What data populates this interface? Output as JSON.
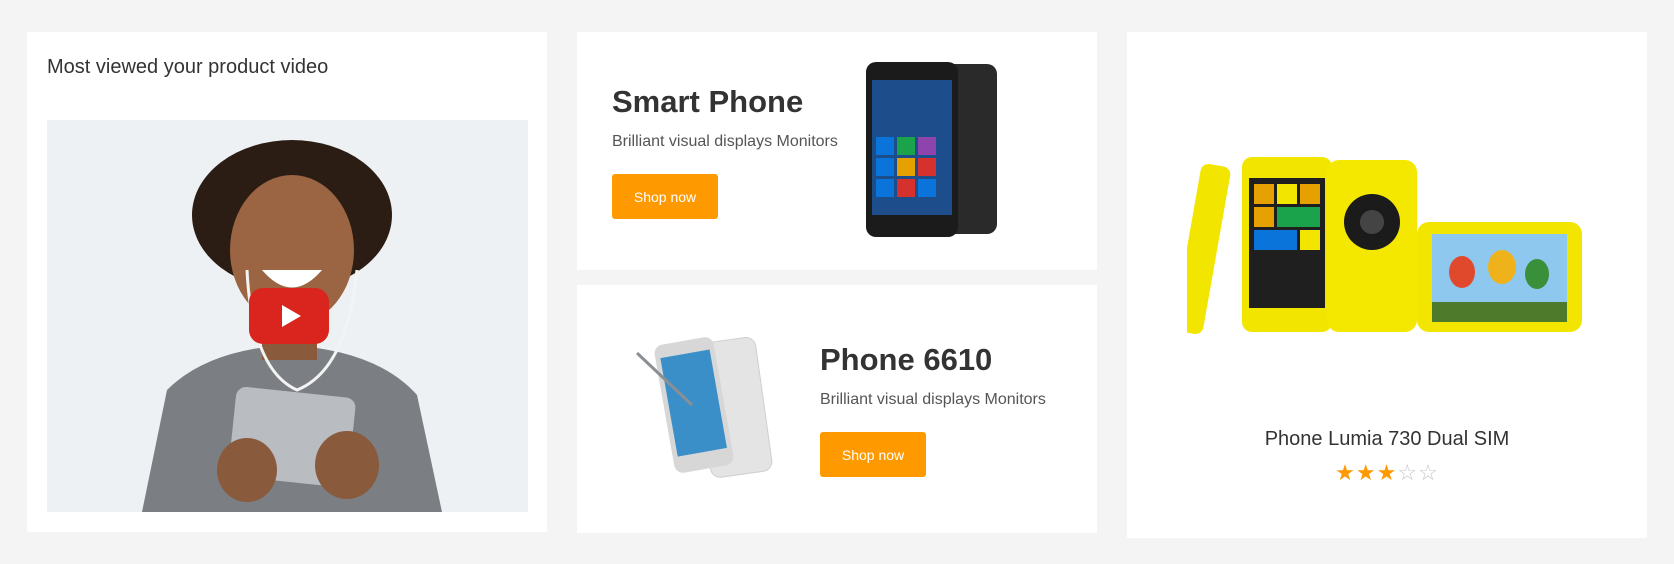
{
  "video_block": {
    "title": "Most viewed your product video",
    "play_icon": "youtube-play-icon"
  },
  "promos": [
    {
      "title": "Smart Phone",
      "subtitle": "Brilliant visual displays Monitors",
      "button": "Shop now"
    },
    {
      "title": "Phone 6610",
      "subtitle": "Brilliant visual displays Monitors",
      "button": "Shop now"
    }
  ],
  "featured_product": {
    "name": "Phone Lumia 730 Dual SIM",
    "rating": 3,
    "rating_max": 5,
    "stars": [
      "★",
      "★",
      "★",
      "☆",
      "☆"
    ]
  },
  "colors": {
    "accent": "#ff9900",
    "play_button": "#d9251d",
    "background": "#f4f4f4",
    "card": "#ffffff"
  }
}
